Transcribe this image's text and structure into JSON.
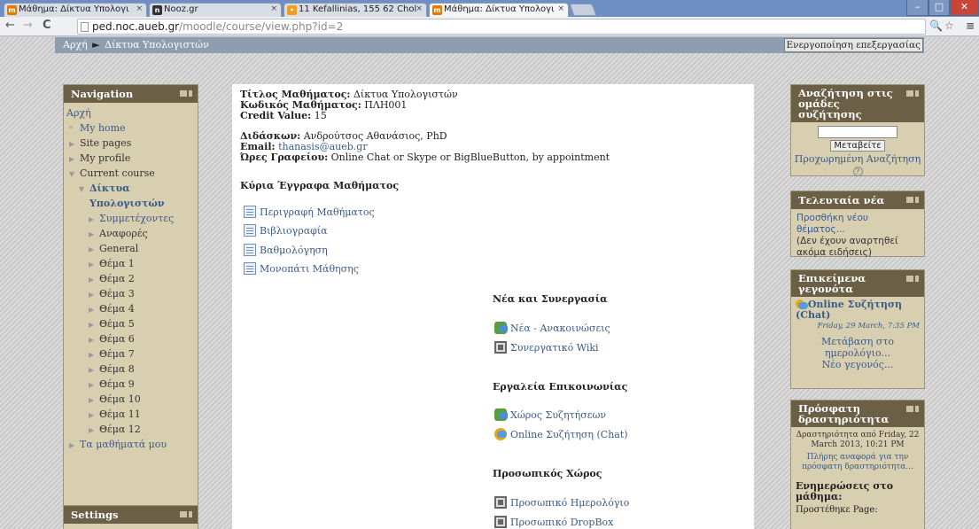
{
  "browser": {
    "tabs": [
      {
        "label": "Μάθημα: Δίκτυα Υπολογι",
        "favicon": "moodle-icon",
        "active": false
      },
      {
        "label": "Nooz.gr",
        "favicon": "nooz-icon",
        "active": false
      },
      {
        "label": "11 Kefallinias, 155 62 Chol",
        "favicon": "maps-icon",
        "active": false
      },
      {
        "label": "Μάθημα: Δίκτυα Υπολογι",
        "favicon": "moodle-icon",
        "active": true
      }
    ],
    "close_glyph": "×",
    "url_host": "ped.noc.aueb.gr",
    "url_path": "/moodle/course/view.php?id=2"
  },
  "breadcrumb": {
    "home": "Αρχή",
    "separator": "►",
    "current": "Δίκτυα Υπολογιστών",
    "edit_button": "Ενεργοποίηση επεξεργασίας"
  },
  "navigation": {
    "title": "Navigation",
    "items": [
      {
        "label": "Αρχή",
        "level": 0,
        "link": true,
        "marker": ""
      },
      {
        "label": "My home",
        "level": 1,
        "link": true,
        "marker": "*"
      },
      {
        "label": "Site pages",
        "level": 1,
        "link": false,
        "marker": "▶"
      },
      {
        "label": "My profile",
        "level": 1,
        "link": false,
        "marker": "▶"
      },
      {
        "label": "Current course",
        "level": 1,
        "link": false,
        "marker": "▼"
      },
      {
        "label": "Δίκτυα",
        "level": 2,
        "link": true,
        "marker": "▼",
        "bold": true
      },
      {
        "label": "Υπολογιστών",
        "level": 2,
        "link": true,
        "marker": "",
        "bold": true
      },
      {
        "label": "Συμμετέχοντες",
        "level": 3,
        "link": true,
        "marker": "▶"
      },
      {
        "label": "Αναφορές",
        "level": 3,
        "link": false,
        "marker": "▶"
      },
      {
        "label": "General",
        "level": 3,
        "link": false,
        "marker": "▶"
      },
      {
        "label": "Θέμα 1",
        "level": 3,
        "link": false,
        "marker": "▶"
      },
      {
        "label": "Θέμα 2",
        "level": 3,
        "link": false,
        "marker": "▶"
      },
      {
        "label": "Θέμα 3",
        "level": 3,
        "link": false,
        "marker": "▶"
      },
      {
        "label": "Θέμα 4",
        "level": 3,
        "link": false,
        "marker": "▶"
      },
      {
        "label": "Θέμα 5",
        "level": 3,
        "link": false,
        "marker": "▶"
      },
      {
        "label": "Θέμα 6",
        "level": 3,
        "link": false,
        "marker": "▶"
      },
      {
        "label": "Θέμα 7",
        "level": 3,
        "link": false,
        "marker": "▶"
      },
      {
        "label": "Θέμα 8",
        "level": 3,
        "link": false,
        "marker": "▶"
      },
      {
        "label": "Θέμα 9",
        "level": 3,
        "link": false,
        "marker": "▶"
      },
      {
        "label": "Θέμα 10",
        "level": 3,
        "link": false,
        "marker": "▶"
      },
      {
        "label": "Θέμα 11",
        "level": 3,
        "link": false,
        "marker": "▶"
      },
      {
        "label": "Θέμα 12",
        "level": 3,
        "link": false,
        "marker": "▶"
      },
      {
        "label": "Τα μαθήματά μου",
        "level": 1,
        "link": true,
        "marker": "▶"
      }
    ]
  },
  "settings": {
    "title": "Settings"
  },
  "course": {
    "title_label": "Τίτλος Μαθήματος:",
    "title_value": "Δίκτυα Υπολογιστών",
    "code_label": "Κωδικός Μαθήματος:",
    "code_value": "ΠΛΗ001",
    "credit_label": "Credit Value:",
    "credit_value": "15",
    "teacher_label": "Διδάσκων:",
    "teacher_value": "Ανδρούτσος Αθανάσιος, PhD",
    "email_label": "Email:",
    "email_value": "thanasis@aueb.gr",
    "hours_label": "Ώρες Γραφείου:",
    "hours_value": "Online Chat or Skype or BigBlueButton, by appointment",
    "docs_title": "Κύρια Έγγραφα Μαθήματος",
    "docs": [
      "Περιγραφή Μαθήματος",
      "Βιβλιογραφία",
      "Βαθμολόγηση",
      "Μονοπάτι Μάθησης"
    ],
    "news_title": "Νέα και Συνεργασία",
    "news_items": [
      "Νέα - Ανακοινώσεις",
      "Συνεργατικό Wiki"
    ],
    "comm_title": "Εργαλεία Επικοινωνίας",
    "comm_items": [
      "Χώρος Συζητήσεων",
      "Online Συζήτηση (Chat)"
    ],
    "personal_title": "Προσωπικός Χώρος",
    "personal_items": [
      "Προσωπικό Ημερολόγιο",
      "Προσωπικό DropBox"
    ]
  },
  "search_block": {
    "title": "Αναζήτηση στις ομάδες συζήτησης",
    "button": "Μεταβείτε",
    "advanced": "Προχωρημένη Αναζήτηση",
    "help_glyph": "?"
  },
  "news_block": {
    "title": "Τελευταία νέα",
    "add_link": "Προσθήκη νέου θέματος...",
    "empty": "(Δεν έχουν αναρτηθεί ακόμα ειδήσεις)"
  },
  "events_block": {
    "title": "Επικείμενα γεγονότα",
    "event_title": "Online Συζήτηση (Chat)",
    "event_date": "Friday, 29 March, 7:35 PM",
    "goto_calendar": "Μετάβαση στο ημερολόγιο...",
    "new_event": "Νέο γεγονός..."
  },
  "recent_block": {
    "title": "Πρόσφατη δραστηριότητα",
    "since": "Δραστηριότητα από Friday, 22 March 2013, 10:21 PM",
    "full_report": "Πλήρης αναφορά για την πρόσφατη δραστηριότητα...",
    "updates_title": "Ενημερώσεις στο μάθημα:",
    "updates_text": "Προστέθηκε Page:"
  }
}
